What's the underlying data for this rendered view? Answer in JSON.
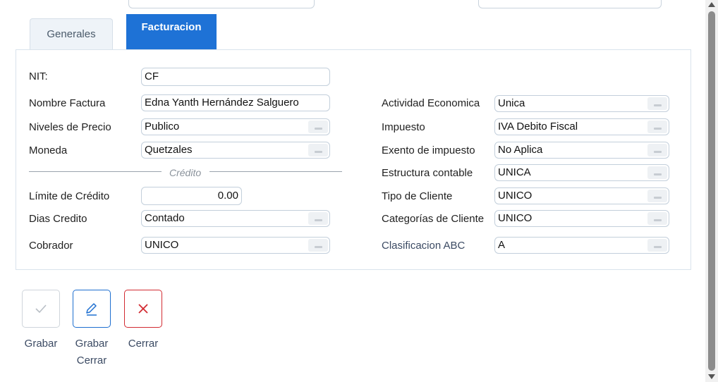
{
  "tabs": {
    "generales": "Generales",
    "facturacion": "Facturacion"
  },
  "form": {
    "nit": {
      "label": "NIT:",
      "value": "CF"
    },
    "nombre_factura": {
      "label": "Nombre Factura",
      "value": "Edna Yanth Hernández Salguero"
    },
    "niveles_precio": {
      "label": "Niveles de Precio",
      "value": "Publico"
    },
    "moneda": {
      "label": "Moneda",
      "value": "Quetzales"
    },
    "credito_section": "Crédito",
    "limite_credito": {
      "label": "Límite de Crédito",
      "value": "0.00"
    },
    "dias_credito": {
      "label": "Dias Credito",
      "value": "Contado"
    },
    "cobrador": {
      "label": "Cobrador",
      "value": "UNICO"
    },
    "actividad_economica": {
      "label": "Actividad Economica",
      "value": "Unica"
    },
    "impuesto": {
      "label": "Impuesto",
      "value": "IVA Debito Fiscal"
    },
    "exento_impuesto": {
      "label": "Exento de impuesto",
      "value": "No Aplica"
    },
    "estructura_contable": {
      "label": "Estructura contable",
      "value": "UNICA"
    },
    "tipo_cliente": {
      "label": "Tipo de Cliente",
      "value": "UNICO"
    },
    "categorias_cliente": {
      "label": "Categorías de Cliente",
      "value": "UNICO"
    },
    "clasificacion_abc": {
      "label": "Clasificacion ABC",
      "value": "A"
    }
  },
  "actions": {
    "grabar": {
      "label": "Grabar",
      "icon": "check-icon"
    },
    "grabar_cerrar": {
      "label_line1": "Grabar",
      "label_line2": "Cerrar",
      "icon": "pencil-icon"
    },
    "cerrar": {
      "label": "Cerrar",
      "icon": "close-icon"
    }
  },
  "colors": {
    "accent": "#1e72d6",
    "danger": "#d22b32"
  }
}
